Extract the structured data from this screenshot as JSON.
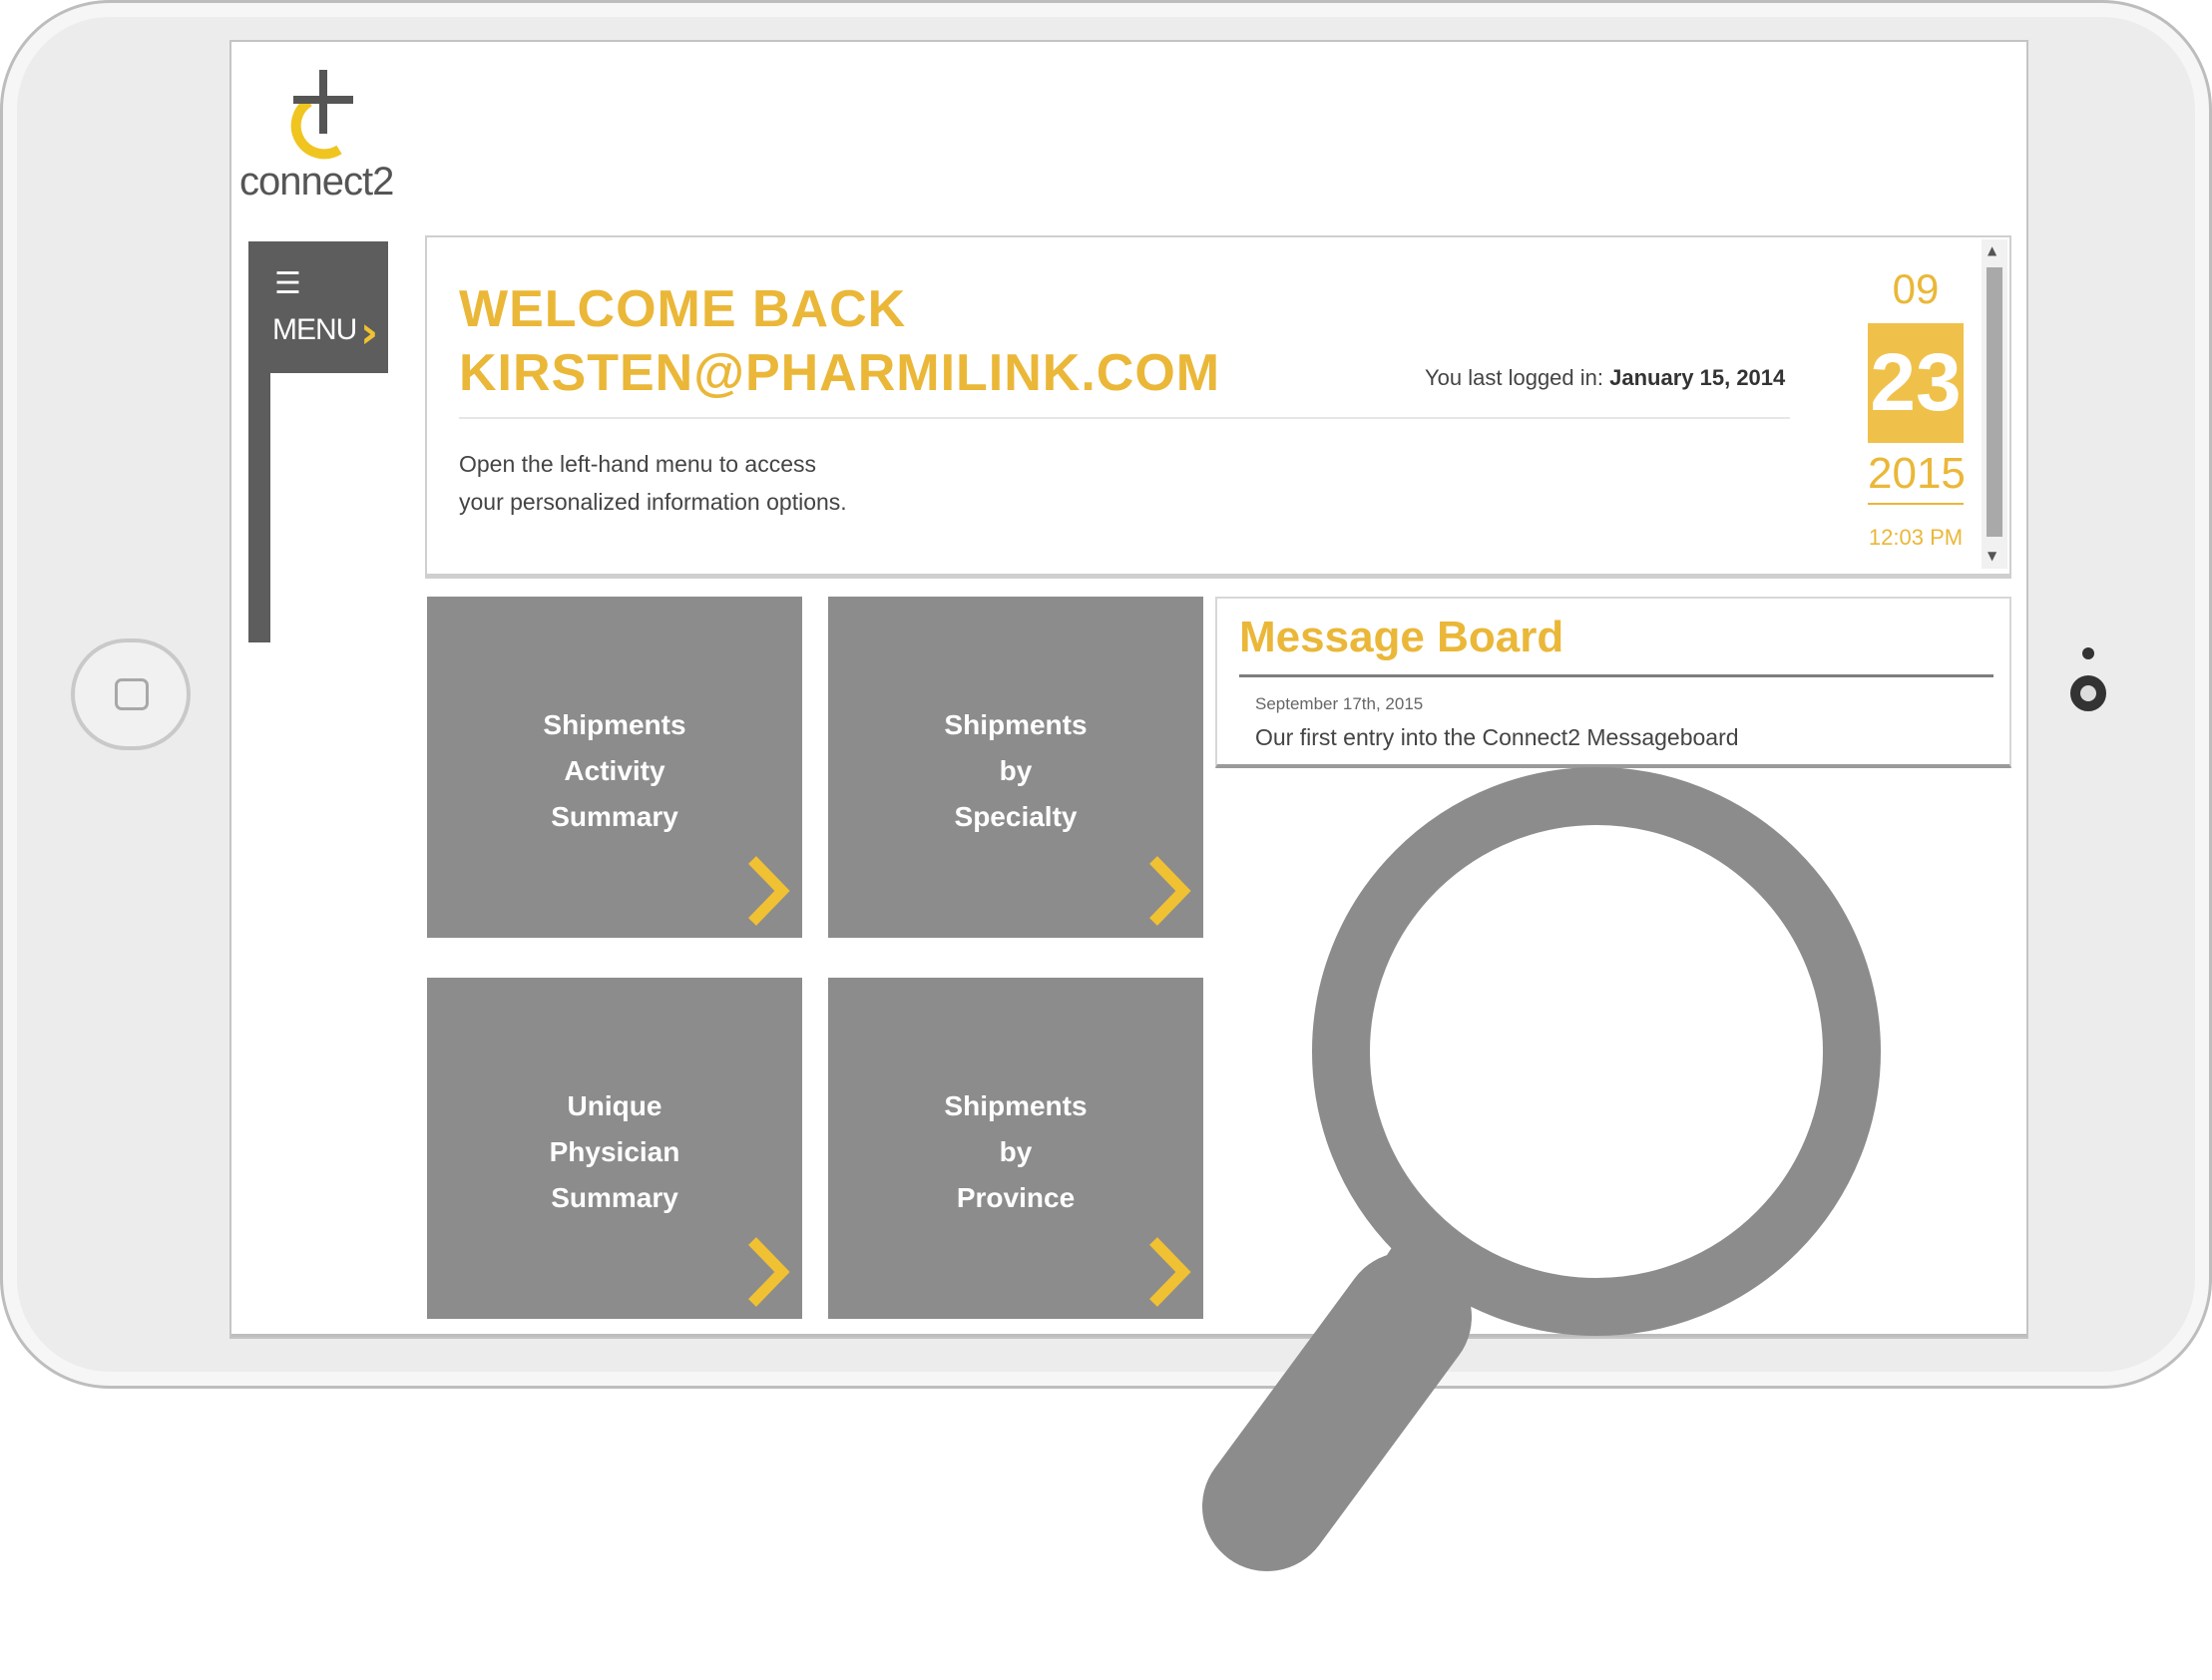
{
  "logo": {
    "text": "connect2"
  },
  "menu": {
    "icon": "hamburger-icon",
    "label": "MENU",
    "chevron_icon": "chevron-right-icon"
  },
  "welcome": {
    "line1": "WELCOME BACK",
    "line2": "KIRSTEN@PHARMILINK.COM",
    "last_login_label": "You last logged in:",
    "last_login_date": "January 15, 2014",
    "desc_line1": "Open the left-hand menu to access",
    "desc_line2": "your personalized information options."
  },
  "date": {
    "month": "09",
    "day": "23",
    "year": "2015",
    "time": "12:03 PM"
  },
  "tiles": [
    {
      "lines": [
        "Shipments",
        "Activity",
        "Summary"
      ]
    },
    {
      "lines": [
        "Shipments",
        "by",
        "Specialty"
      ]
    },
    {
      "lines": [
        "Unique",
        "Physician",
        "Summary"
      ]
    },
    {
      "lines": [
        "Shipments",
        "by",
        "Province"
      ]
    }
  ],
  "message_board": {
    "title": "Message Board",
    "entry_date": "September 17th, 2015",
    "entry_text": "Our first entry into the Connect2 Messageboard"
  },
  "colors": {
    "accent": "#eab738",
    "tile_bg": "#8c8c8c",
    "menu_bg": "#5d5d5d"
  },
  "overlay_icon": "magnifier-icon"
}
